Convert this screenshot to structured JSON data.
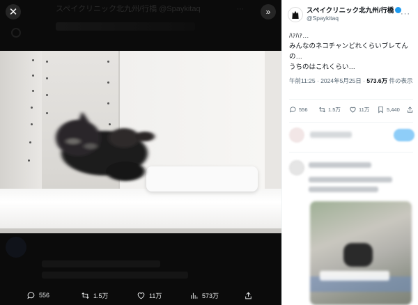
{
  "viewer": {
    "close_glyph": "✕",
    "next_glyph": "»",
    "blurred_header_text": "スペイクリニック北九州/行橋 @Spaykitaq"
  },
  "media_bar": {
    "reply_count": "556",
    "retweet_count": "1.5万",
    "like_count": "11万",
    "view_count": "573万"
  },
  "tweet": {
    "display_name": "スペイクリニック北九州/行橋",
    "handle": "@Spaykitaq",
    "more_glyph": "···",
    "text": "ﾊｧﾊｧ…\nみんなのネコチャンどれくらいブレてんの…\nうちのはこれくらい…",
    "timestamp": "午前11:25 · 2024年5月25日 · ",
    "views_value": "573.6万",
    "views_suffix": " 件の表示"
  },
  "actions": {
    "reply_count": "556",
    "retweet_count": "1.5万",
    "like_count": "11万",
    "bookmark_count": "5,440"
  },
  "colors": {
    "accent": "#1d9bf0",
    "text_primary": "#0f1419",
    "text_secondary": "#536471"
  }
}
